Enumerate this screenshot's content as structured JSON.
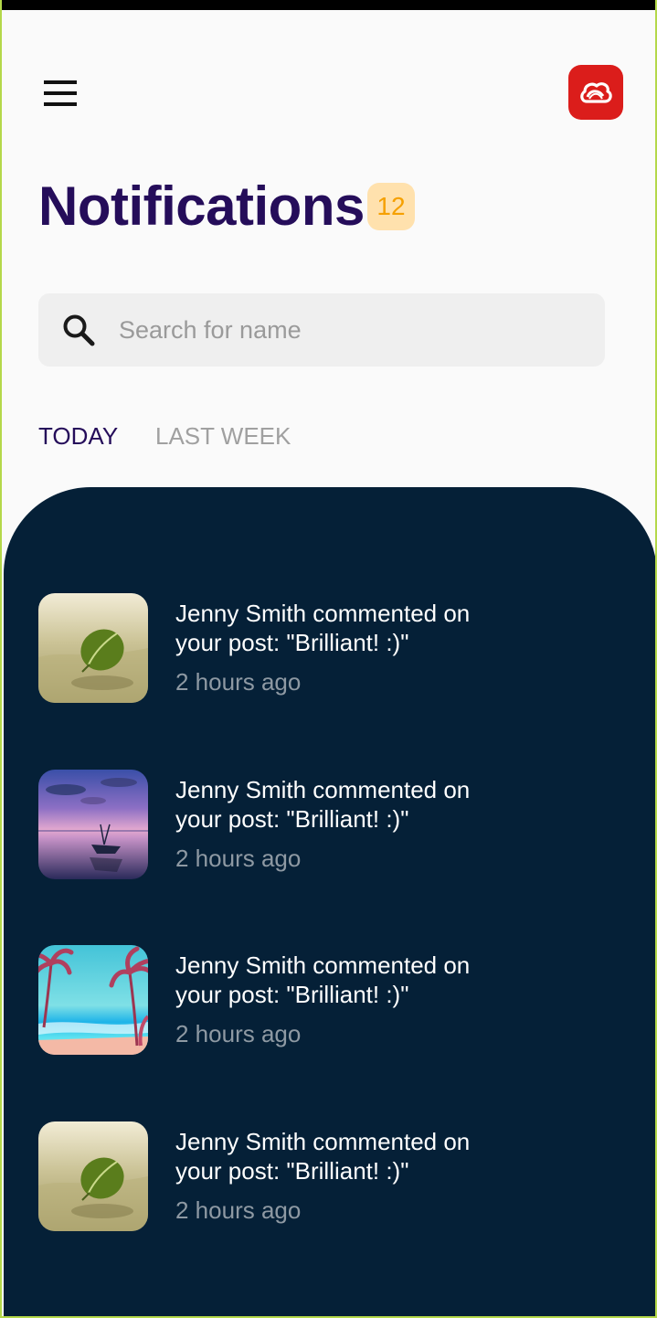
{
  "header": {
    "menu_icon": "hamburger-menu-icon",
    "logo_icon": "creative-cloud-logo",
    "logo_color": "#db1d1b"
  },
  "title": "Notifications",
  "badge_count": "12",
  "search": {
    "icon": "search-icon",
    "placeholder": "Search for name",
    "value": ""
  },
  "tabs": [
    {
      "label": "TODAY",
      "active": true
    },
    {
      "label": "LAST WEEK",
      "active": false
    }
  ],
  "colors": {
    "title": "#250d5a",
    "panel_background": "#052037",
    "badge_background": "#ffe1ad",
    "badge_text": "#f5a000",
    "inactive_tab": "#a0a0a0"
  },
  "notifications": [
    {
      "thumbnail": "leaf-on-beach",
      "message": "Jenny Smith commented on your post: \"Brilliant! :)\"",
      "time": "2 hours ago"
    },
    {
      "thumbnail": "boat-at-sunset",
      "message": "Jenny Smith commented on your post: \"Brilliant! :)\"",
      "time": "2 hours ago"
    },
    {
      "thumbnail": "tropical-beach-palms",
      "message": "Jenny Smith commented on your post: \"Brilliant! :)\"",
      "time": "2 hours ago"
    },
    {
      "thumbnail": "leaf-on-beach",
      "message": "Jenny Smith commented on your post: \"Brilliant! :)\"",
      "time": "2 hours ago"
    }
  ]
}
